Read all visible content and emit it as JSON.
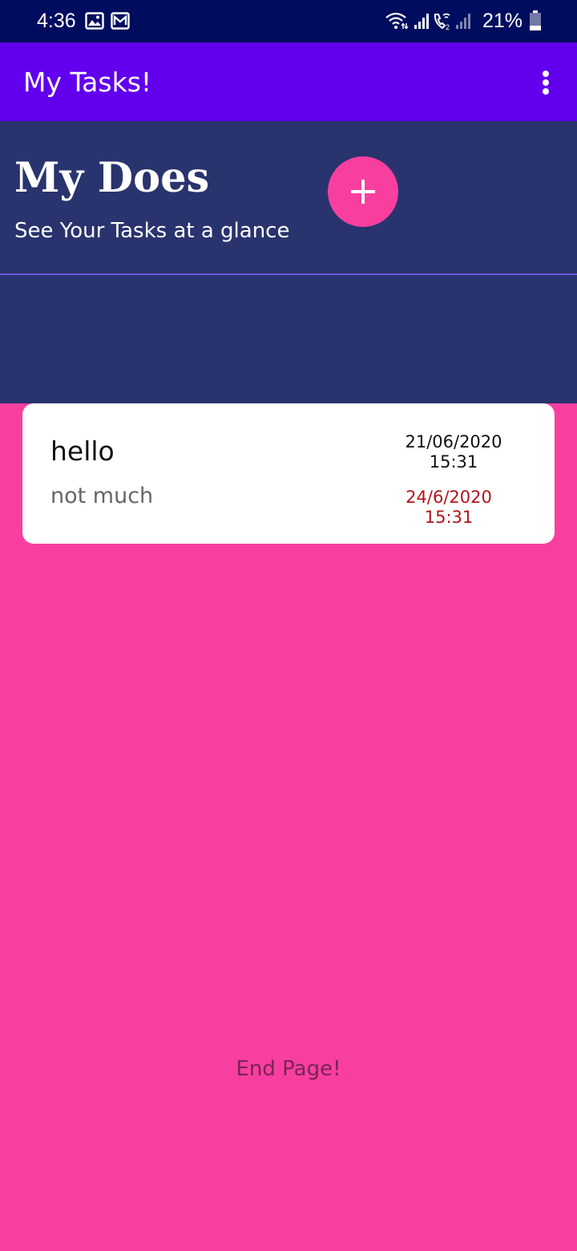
{
  "status_bar": {
    "time": "4:36",
    "battery_percent": "21%",
    "icons": [
      "gallery-icon",
      "gmail-icon",
      "wifi-icon",
      "signal-icon",
      "wifi-calling-icon",
      "signal-weak-icon",
      "battery-icon"
    ]
  },
  "app_bar": {
    "title": "My Tasks!",
    "menu_icon": "more-vert-icon"
  },
  "header": {
    "title": "My Does",
    "subtitle": "See Your Tasks at a glance",
    "add_button_icon": "plus-icon"
  },
  "tasks": [
    {
      "title": "hello",
      "description": "not much",
      "created_date": "21/06/2020",
      "created_time": "15:31",
      "due_date": "24/6/2020",
      "due_time": "15:31"
    }
  ],
  "footer": {
    "end_text": "End Page!"
  },
  "colors": {
    "status_bar": "#000d5e",
    "app_bar": "#6200ee",
    "header": "#29336d",
    "accent": "#f83fa0",
    "due_text": "#b0141c"
  }
}
